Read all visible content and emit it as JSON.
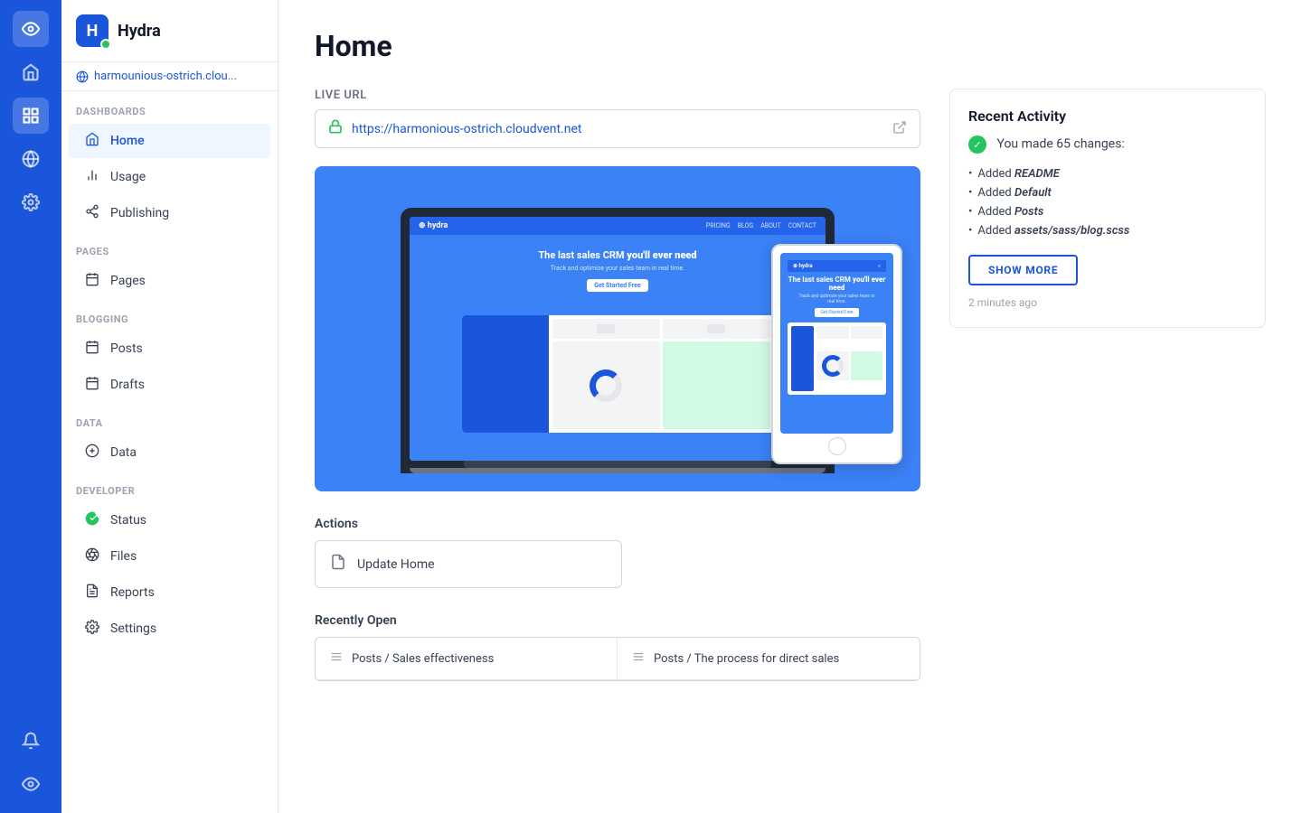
{
  "iconbar": {
    "icons": [
      {
        "name": "eye-icon",
        "symbol": "◎",
        "active": false
      },
      {
        "name": "home-icon",
        "symbol": "⌂",
        "active": false
      },
      {
        "name": "layout-icon",
        "symbol": "▣",
        "active": true
      },
      {
        "name": "globe-icon",
        "symbol": "⊕",
        "active": false
      },
      {
        "name": "settings-icon",
        "symbol": "⚙",
        "active": false
      }
    ],
    "bottom_icons": [
      {
        "name": "bell-icon",
        "symbol": "🔔",
        "active": false
      },
      {
        "name": "user-icon",
        "symbol": "⊙",
        "active": false
      }
    ]
  },
  "sidebar": {
    "app_name": "Hydra",
    "url": "harmounious-ostrich.clou...",
    "sections": [
      {
        "label": "DASHBOARDS",
        "items": [
          {
            "label": "Home",
            "icon": "⌂",
            "active": true,
            "name": "home"
          },
          {
            "label": "Usage",
            "icon": "📊",
            "active": false,
            "name": "usage"
          },
          {
            "label": "Publishing",
            "icon": "⚡",
            "active": false,
            "name": "publishing"
          }
        ]
      },
      {
        "label": "PAGES",
        "items": [
          {
            "label": "Pages",
            "icon": "📅",
            "active": false,
            "name": "pages"
          }
        ]
      },
      {
        "label": "BLOGGING",
        "items": [
          {
            "label": "Posts",
            "icon": "📋",
            "active": false,
            "name": "posts"
          },
          {
            "label": "Drafts",
            "icon": "📅",
            "active": false,
            "name": "drafts"
          }
        ]
      },
      {
        "label": "DATA",
        "items": [
          {
            "label": "Data",
            "icon": "◯",
            "active": false,
            "name": "data"
          }
        ]
      },
      {
        "label": "DEVELOPER",
        "items": [
          {
            "label": "Status",
            "icon": "✓",
            "active": false,
            "name": "status",
            "status_green": true
          },
          {
            "label": "Files",
            "icon": "◎",
            "active": false,
            "name": "files"
          },
          {
            "label": "Reports",
            "icon": "📄",
            "active": false,
            "name": "reports"
          },
          {
            "label": "Settings",
            "icon": "⚙",
            "active": false,
            "name": "settings"
          }
        ]
      }
    ]
  },
  "main": {
    "title": "Home",
    "live_url_label": "Live URL",
    "live_url": "https://harmonious-ostrich.cloudvent.net",
    "actions_label": "Actions",
    "actions": [
      {
        "label": "Update Home",
        "name": "update-home"
      }
    ],
    "recently_open_label": "Recently Open",
    "recently_open": [
      {
        "label": "Posts / Sales effectiveness",
        "name": "posts-sales-effectiveness"
      },
      {
        "label": "Posts / The process for direct sales",
        "name": "posts-direct-sales"
      },
      {
        "label": "",
        "name": "item-3"
      },
      {
        "label": "",
        "name": "item-4"
      }
    ]
  },
  "activity": {
    "title": "Recent Activity",
    "summary": "You made 65 changes:",
    "items": [
      {
        "text": "Added ",
        "bold": "README"
      },
      {
        "text": "Added ",
        "bold": "Default"
      },
      {
        "text": "Added ",
        "bold": "Posts"
      },
      {
        "text": "Added ",
        "bold": "assets/sass/blog.scss"
      }
    ],
    "show_more_label": "SHOW MORE",
    "time": "2 minutes ago"
  }
}
